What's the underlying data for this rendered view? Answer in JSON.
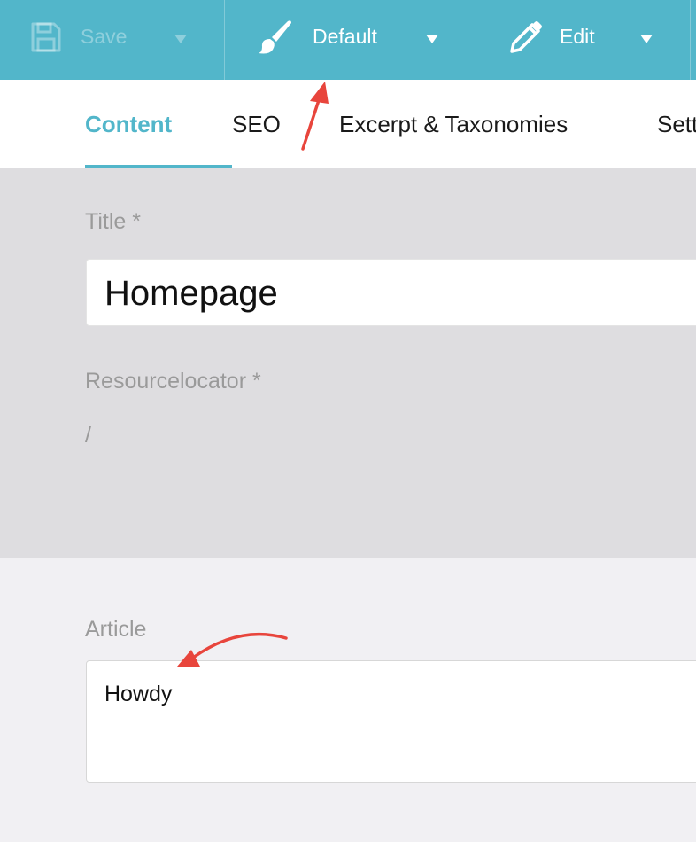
{
  "toolbar": {
    "save": {
      "label": "Save",
      "icon": "floppy-disk-icon",
      "enabled": false
    },
    "template": {
      "label": "Default",
      "icon": "paintbrush-icon"
    },
    "edit": {
      "label": "Edit",
      "icon": "pencil-icon"
    }
  },
  "tabs": [
    {
      "label": "Content",
      "active": true
    },
    {
      "label": "SEO",
      "active": false
    },
    {
      "label": "Excerpt & Taxonomies",
      "active": false
    },
    {
      "label": "Settings",
      "active": false
    }
  ],
  "form": {
    "title": {
      "label": "Title *",
      "value": "Homepage"
    },
    "resourcelocator": {
      "label": "Resourcelocator *",
      "value": "/"
    },
    "article": {
      "label": "Article",
      "value": "Howdy"
    }
  },
  "colors": {
    "accent": "#52b6ca",
    "annotation_arrow": "#e8453c",
    "gray_section": "#dedde0",
    "page_background": "#f1f0f3"
  }
}
